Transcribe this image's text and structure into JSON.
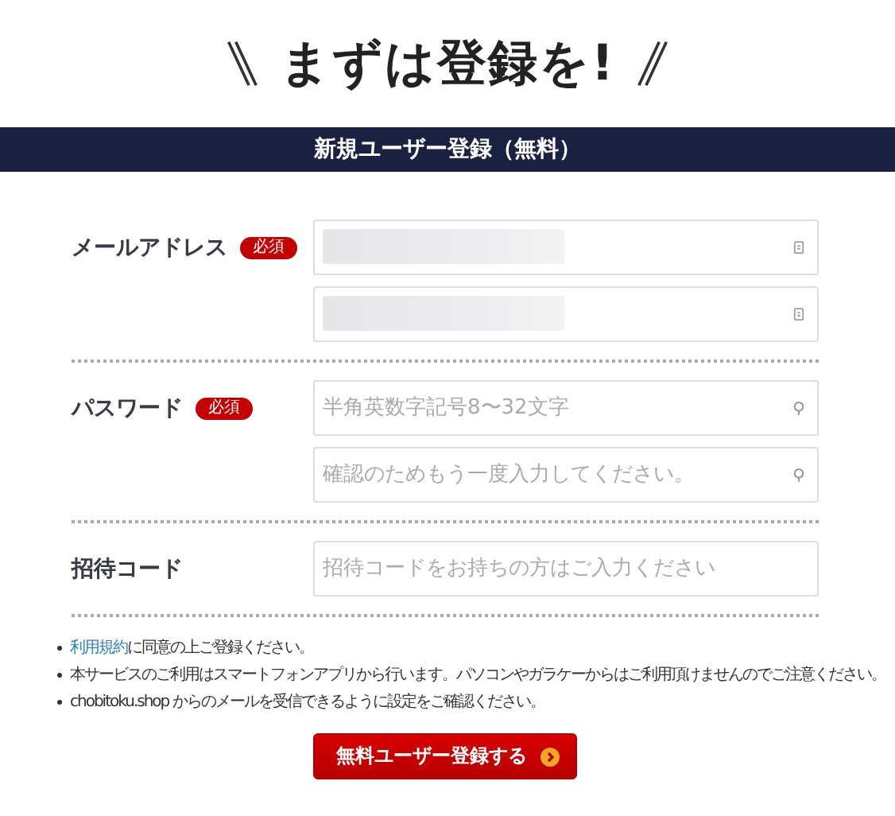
{
  "heading": "まずは登録を!",
  "banner": "新規ユーザー登録（無料）",
  "fields": [
    {
      "label": "メールアドレス",
      "required": true,
      "badge": "必須",
      "kind": "email",
      "inputs": [
        {
          "kind": "redacted"
        },
        {
          "kind": "redacted"
        }
      ]
    },
    {
      "label": "パスワード",
      "required": true,
      "badge": "必須",
      "kind": "password",
      "inputs": [
        {
          "kind": "empty",
          "placeholder": "半角英数字記号8〜32文字"
        },
        {
          "kind": "empty",
          "placeholder": "確認のためもう一度入力してください。"
        }
      ]
    },
    {
      "label": "招待コード",
      "required": false,
      "kind": "text",
      "inputs": [
        {
          "kind": "empty",
          "placeholder": "招待コードをお持ちの方はご入力ください"
        }
      ]
    }
  ],
  "notes": [
    {
      "link": "利用規約",
      "text": "に同意の上ご登録ください。"
    },
    {
      "text": "本サービスのご利用はスマートフォンアプリから行います。パソコンやガラケーからはご利用頂けませんのでご注意ください。"
    },
    {
      "text": "chobitoku.shop からのメールを受信できるように設定をご確認ください。"
    }
  ],
  "submit": "無料ユーザー登録する"
}
